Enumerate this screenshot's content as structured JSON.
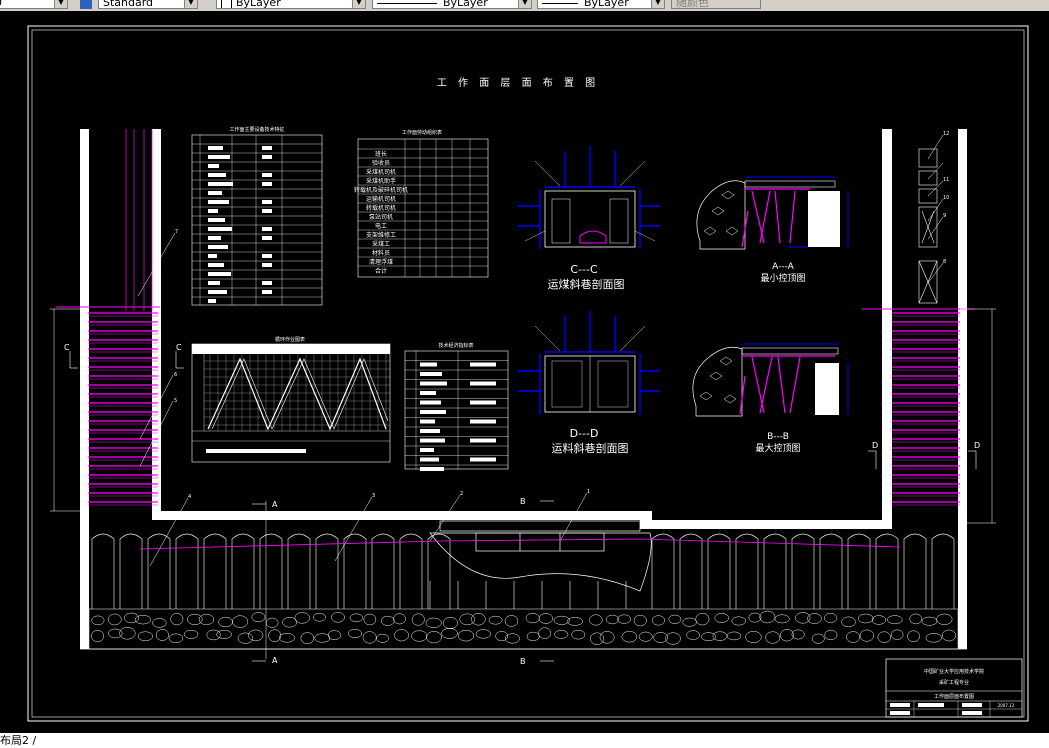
{
  "toolbar": {
    "style_value": "Standard",
    "layer_value": "ByLayer",
    "linetype_value": "ByLayer",
    "lineweight_value": "ByLayer",
    "color_value": "随颜色"
  },
  "drawing": {
    "title": "工 作 面 层 面 布 置 图",
    "table1_title": "工作面主要设备技术特征",
    "table2_title": "工作面劳动组织表",
    "table3_title": "循环作业图表",
    "table4_title": "技术经济指标表",
    "section_cc_label": "C---C",
    "section_cc_caption": "运煤斜巷剖面图",
    "section_dd_label": "D---D",
    "section_dd_caption": "运料斜巷剖面图",
    "section_aa_label": "A---A",
    "section_aa_caption": "最小控顶图",
    "section_bb_label": "B---B",
    "section_bb_caption": "最大控顶图",
    "cut_a": "A",
    "cut_b": "B",
    "cut_c": "C",
    "cut_d": "D",
    "callouts": [
      "1",
      "2",
      "3",
      "4",
      "5",
      "6",
      "7",
      "8",
      "9",
      "10",
      "11",
      "12"
    ],
    "labor_rows": [
      "班长",
      "验收员",
      "采煤机司机",
      "采煤机助手",
      "转载机及破碎机司机",
      "运输机司机",
      "转载机司机",
      "泵站司机",
      "电工",
      "支架维修工",
      "采煤工",
      "材料员",
      "清理浮煤",
      "合计"
    ],
    "title_block_line1": "中国矿业大学应用技术学院",
    "title_block_line2": "采矿工程专业",
    "title_block_line3": "工作面层面布置图",
    "title_block_code": "2007.12"
  },
  "status": {
    "layout_tab": "布局2"
  }
}
